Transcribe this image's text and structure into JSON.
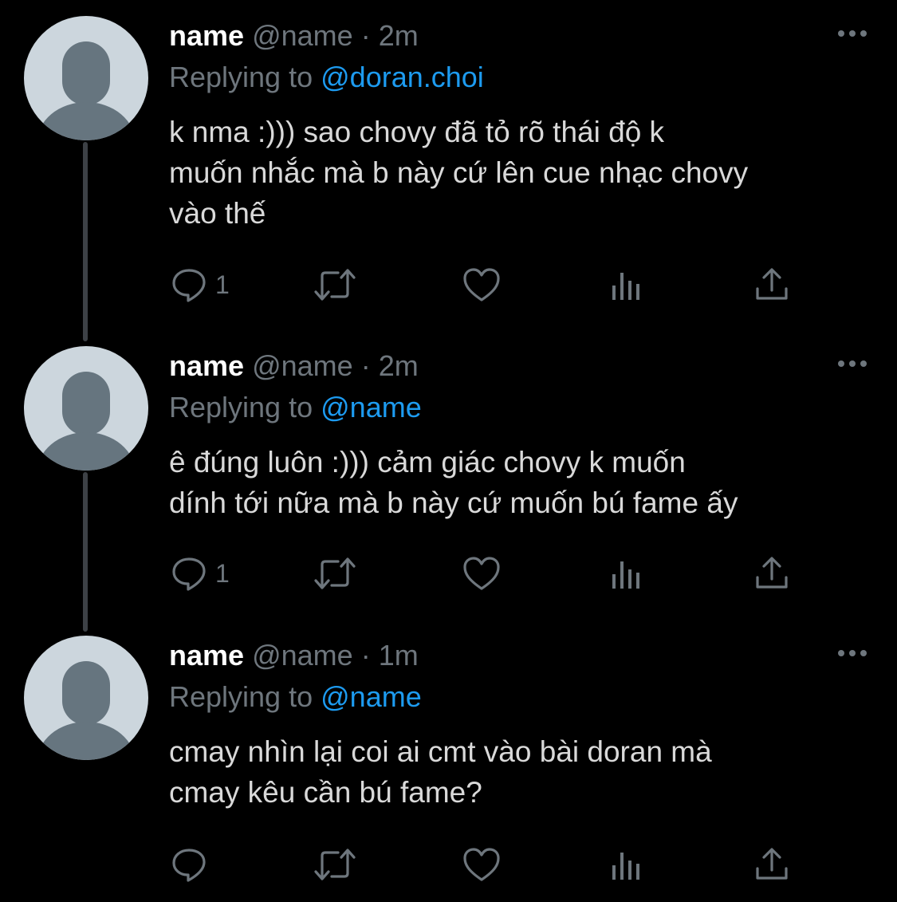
{
  "tweets": [
    {
      "name": "name",
      "handle": "@name",
      "dot": "·",
      "time": "2m",
      "replying_prefix": "Replying to",
      "replying_to": "@doran.choi",
      "lines": [
        "k nma :))) sao chovy đã tỏ rõ thái độ k",
        "muốn nhắc mà b này cứ lên cue nhạc chovy",
        "vào thế"
      ],
      "reply_count": "1"
    },
    {
      "name": "name",
      "handle": "@name",
      "dot": "·",
      "time": "2m",
      "replying_prefix": "Replying to",
      "replying_to": "@name",
      "lines": [
        "ê đúng luôn :))) cảm giác chovy k muốn",
        "dính tới nữa mà b này cứ muốn bú fame ấy"
      ],
      "reply_count": "1"
    },
    {
      "name": "name",
      "handle": "@name",
      "dot": "·",
      "time": "1m",
      "replying_prefix": "Replying to",
      "replying_to": "@name",
      "lines": [
        "cmay nhìn lại coi ai cmt vào bài doran mà",
        "cmay kêu cần bú fame?"
      ],
      "reply_count": ""
    }
  ],
  "icons": {
    "reply": "reply-icon",
    "retweet": "retweet-icon",
    "like": "like-icon",
    "views": "views-icon",
    "share": "share-icon",
    "more": "more-icon",
    "avatar": "default-avatar-icon"
  },
  "colors": {
    "background": "#000000",
    "text": "#d9d9d9",
    "muted": "#6e767d",
    "link": "#1d9bf0",
    "avatar_bg": "#ccd6dd",
    "avatar_fg": "#66757f",
    "thread_line": "#3d4146"
  }
}
